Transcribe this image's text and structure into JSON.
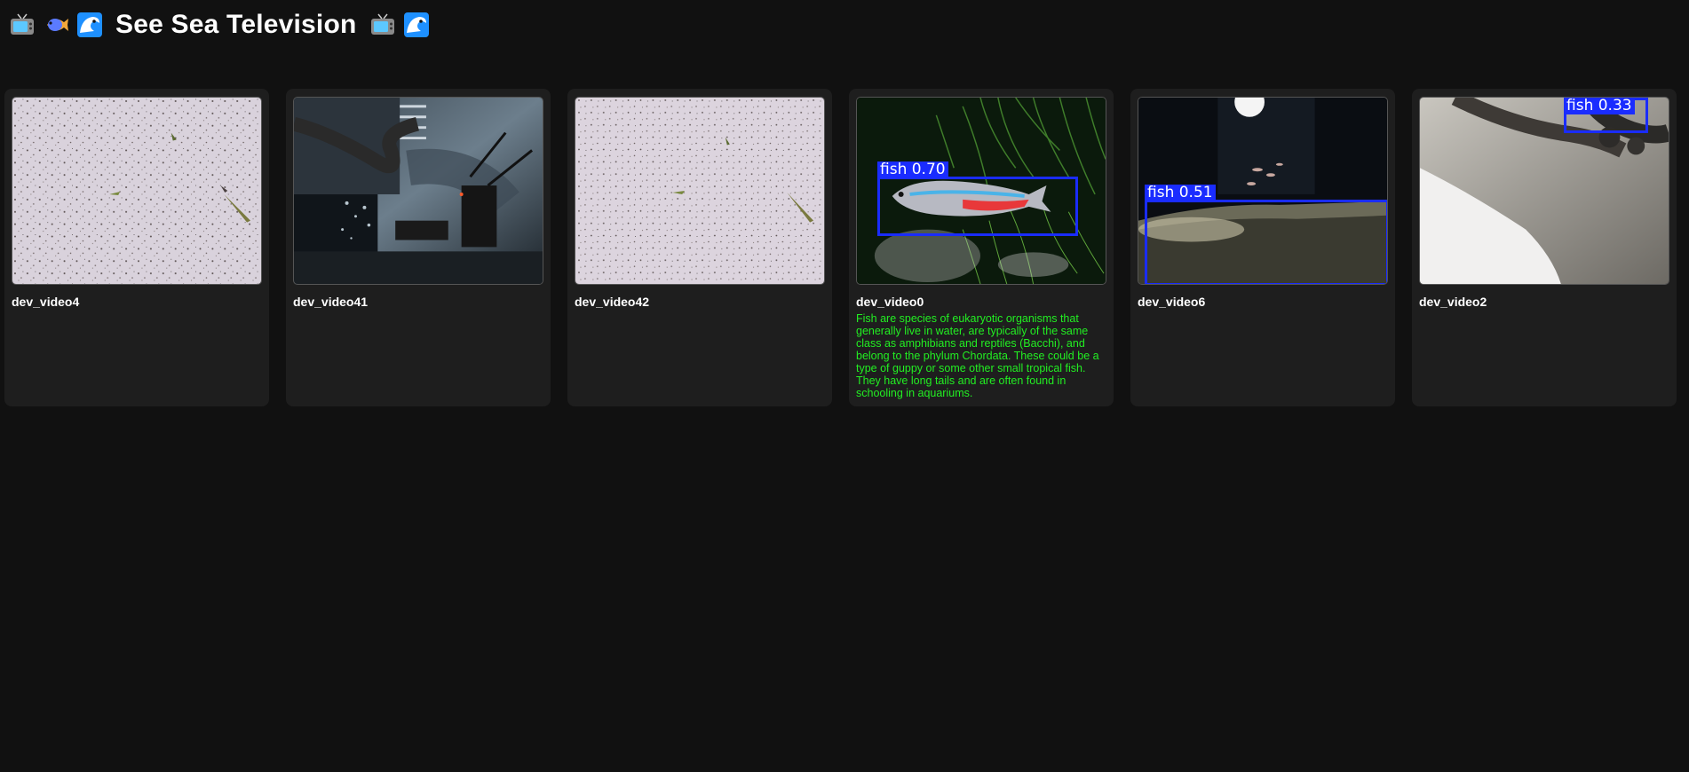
{
  "header": {
    "title": "See Sea Television",
    "icons_left": [
      "tv-icon",
      "fish-icon",
      "wave-icon"
    ],
    "icons_right": [
      "tv-icon",
      "wave-icon"
    ]
  },
  "cameras": [
    {
      "label": "dev_video4",
      "description": "",
      "detections": []
    },
    {
      "label": "dev_video41",
      "description": "",
      "detections": []
    },
    {
      "label": "dev_video42",
      "description": "",
      "detections": []
    },
    {
      "label": "dev_video0",
      "description": "Fish are species of eukaryotic organisms that generally live in water, are typically of the same class as amphibians and reptiles (Bacchi), and belong to the phylum Chordata. These could be a type of guppy or some other small tropical fish. They have long tails and are often found in schooling in aquariums.",
      "detections": [
        {
          "label": "fish 0.70"
        }
      ]
    },
    {
      "label": "dev_video6",
      "description": "",
      "detections": [
        {
          "label": "fish 0.51"
        }
      ]
    },
    {
      "label": "dev_video2",
      "description": "",
      "detections": [
        {
          "label": "fish 0.33"
        }
      ]
    }
  ],
  "colors": {
    "background": "#111111",
    "card": "#1e1e1e",
    "description_text": "#22ee22",
    "detection_box": "#1a2cff"
  }
}
